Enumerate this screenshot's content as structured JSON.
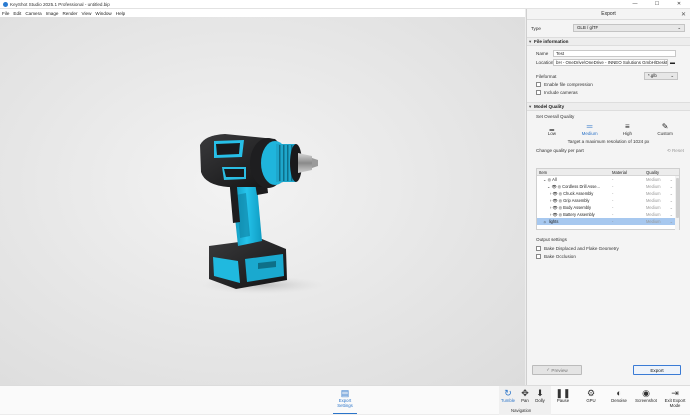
{
  "window": {
    "title": "KeyShot Studio 2025.1 Professional - untitled.bip",
    "controls": [
      "—",
      "☐",
      "✕"
    ]
  },
  "menu": [
    "File",
    "Edit",
    "Camera",
    "Image",
    "Render",
    "View",
    "Window",
    "Help"
  ],
  "panel": {
    "title": "Export",
    "type_label": "Type",
    "type_value": "GLB / glTF",
    "file_info": {
      "section": "File information",
      "name_label": "Name",
      "name_value": "Test",
      "location_label": "Location",
      "location_value": "bH - OneDrive\\OneDrive - INNEO Solutions GmbH\\Desktop",
      "fileformat_label": "Fileformat",
      "fileformat_value": "*.glb",
      "compression_label": "Enable file compression",
      "cameras_label": "Include cameras"
    },
    "model_quality": {
      "section": "Model Quality",
      "overall_label": "Set Overall Quality",
      "options": [
        {
          "label": "Low",
          "icon": "low-quality-icon",
          "active": false
        },
        {
          "label": "Medium",
          "icon": "medium-quality-icon",
          "active": true
        },
        {
          "label": "High",
          "icon": "high-quality-icon",
          "active": false
        },
        {
          "label": "Custom",
          "icon": "custom-quality-icon",
          "active": false
        }
      ],
      "target_text": "Target a maximum resolution of 1024 px",
      "per_part_label": "Change quality per part",
      "reset_label": "Reset",
      "table": {
        "headers": [
          "Item",
          "Material",
          "Quality"
        ],
        "rows": [
          {
            "item": "All",
            "material": "-",
            "quality": "Medium"
          },
          {
            "item": "Cordless Drill Asse...",
            "material": "-",
            "quality": "Medium"
          },
          {
            "item": "Chuck Assembly",
            "material": "-",
            "quality": "Medium"
          },
          {
            "item": "Grip Assembly",
            "material": "-",
            "quality": "Medium"
          },
          {
            "item": "Body Assembly",
            "material": "-",
            "quality": "Medium"
          },
          {
            "item": "Battery Assembly",
            "material": "-",
            "quality": "Medium"
          },
          {
            "item": "lights",
            "material": "-",
            "quality": "Medium"
          }
        ]
      }
    },
    "output": {
      "label": "Output settings",
      "bake_geometry": "Bake Displaced and Flake Geometry",
      "bake_occlusion": "Bake Occlusion"
    },
    "preview_label": "Preview",
    "export_label": "Export"
  },
  "toolbar": {
    "export_settings": "Export Settings",
    "tumble": "Tumble",
    "pan": "Pan",
    "dolly": "Dolly",
    "navigation": "Navigation",
    "pause": "Pause",
    "gpu": "GPU",
    "denoise": "Denoise",
    "screenshot": "Screenshot",
    "exit_export": "Exit Export Mode"
  },
  "colors": {
    "accent": "#2a74c9",
    "drill_cyan": "#1bb6dd",
    "drill_black": "#1d1d1f"
  }
}
